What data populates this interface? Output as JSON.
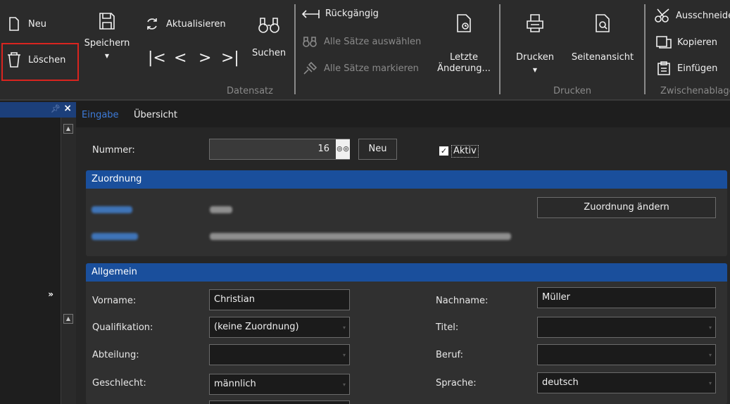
{
  "ribbon": {
    "neu": "Neu",
    "loeschen": "Löschen",
    "speichern": "Speichern",
    "aktualisieren": "Aktualisieren",
    "suchen": "Suchen",
    "rueckgaengig": "Rückgängig",
    "alle_auswaehlen": "Alle Sätze auswählen",
    "alle_markieren": "Alle Sätze markieren",
    "letzte_line1": "Letzte",
    "letzte_line2": "Änderung...",
    "drucken": "Drucken",
    "seitenansicht": "Seitenansicht",
    "ausschneiden": "Ausschneiden",
    "kopieren": "Kopieren",
    "einfuegen": "Einfügen",
    "group_datensatz": "Datensatz",
    "group_drucken": "Drucken",
    "group_zwischenablage": "Zwischenablage"
  },
  "tabs": {
    "eingabe": "Eingabe",
    "uebersicht": "Übersicht"
  },
  "form": {
    "nummer_label": "Nummer:",
    "nummer_value": "16",
    "neu_button": "Neu",
    "aktiv_label": "Aktiv",
    "aktiv_checked": true,
    "zuordnung_title": "Zuordnung",
    "zuordnung_button": "Zuordnung ändern",
    "allgemein_title": "Allgemein",
    "vorname_label": "Vorname:",
    "vorname_value": "Christian",
    "nachname_label": "Nachname:",
    "nachname_value": "Müller",
    "qualifikation_label": "Qualifikation:",
    "qualifikation_value": "(keine Zuordnung)",
    "titel_label": "Titel:",
    "titel_value": "",
    "abteilung_label": "Abteilung:",
    "abteilung_value": "",
    "beruf_label": "Beruf:",
    "beruf_value": "",
    "geschlecht_label": "Geschlecht:",
    "geschlecht_value": "männlich",
    "sprache_label": "Sprache:",
    "sprache_value": "deutsch"
  },
  "icons": {
    "new": "new-document-icon",
    "delete": "trash-icon",
    "save": "floppy-icon",
    "refresh": "refresh-icon",
    "search": "binoculars-icon",
    "undo": "undo-icon",
    "select_all": "binoculars-icon",
    "mark_all": "pin-icon",
    "last_change": "document-clock-icon",
    "print": "printer-icon",
    "preview": "document-magnifier-icon",
    "cut": "scissors-icon",
    "copy": "copy-icon",
    "paste": "clipboard-icon"
  },
  "colors": {
    "accent": "#1a4f9c",
    "highlight": "#d9241f",
    "tab_active": "#3d7bd9"
  }
}
